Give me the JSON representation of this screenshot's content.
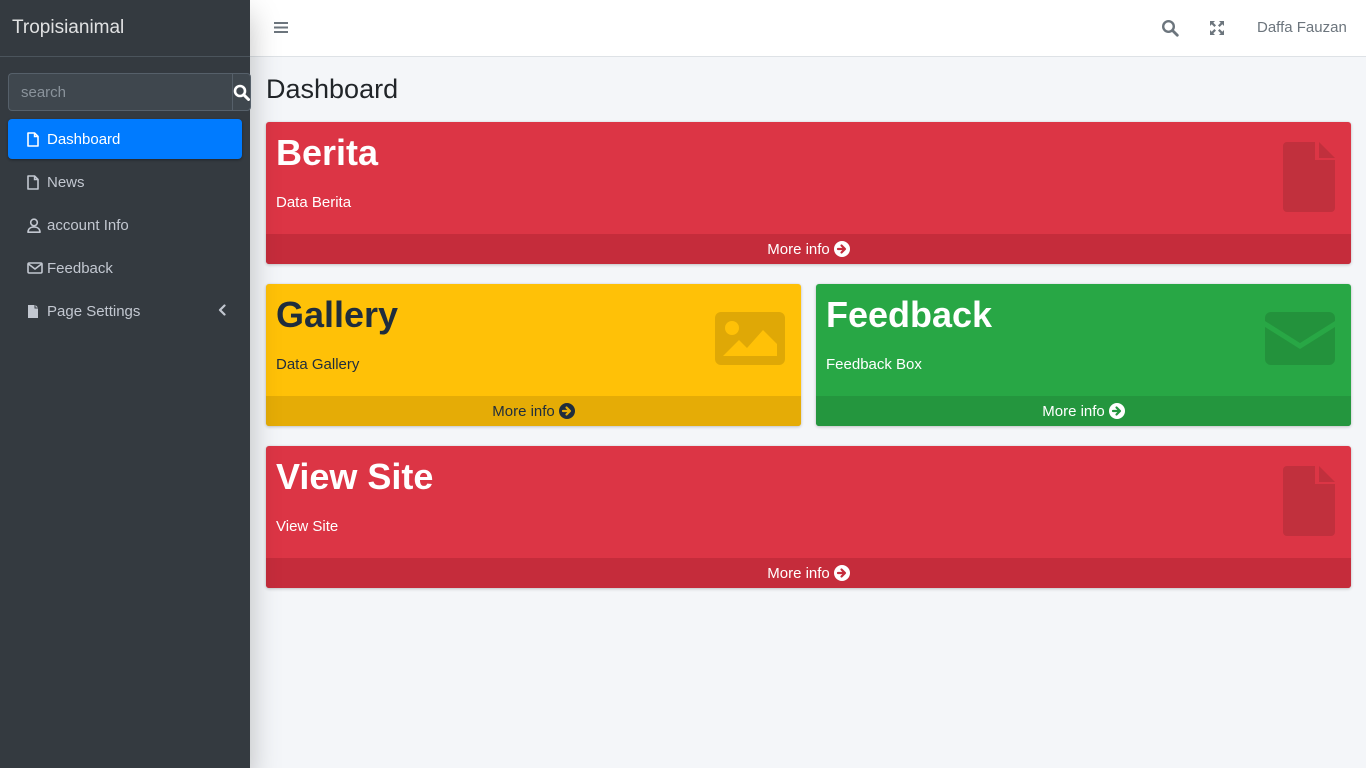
{
  "app": {
    "brand": "Tropisianimal"
  },
  "sidebar": {
    "search": {
      "placeholder": "search",
      "value": ""
    },
    "items": [
      {
        "label": "Dashboard",
        "icon": "file-icon",
        "active": true
      },
      {
        "label": "News",
        "icon": "file-icon"
      },
      {
        "label": "account Info",
        "icon": "user-icon"
      },
      {
        "label": "Feedback",
        "icon": "envelope-icon"
      },
      {
        "label": "Page Settings",
        "icon": "file-filled-icon",
        "has_caret": true
      }
    ]
  },
  "topbar": {
    "user_name": "Daffa Fauzan",
    "icons": [
      "menu-icon",
      "search-icon",
      "expand-icon"
    ]
  },
  "page": {
    "title": "Dashboard"
  },
  "boxes": [
    {
      "title": "Berita",
      "subtitle": "Data Berita",
      "footer": "More info",
      "color": "#dc3545",
      "icon": "file-icon"
    },
    {
      "title": "Gallery",
      "subtitle": "Data Gallery",
      "footer": "More info",
      "color": "#ffc107",
      "icon": "image-icon"
    },
    {
      "title": "Feedback",
      "subtitle": "Feedback Box",
      "footer": "More info",
      "color": "#28a745",
      "icon": "envelope-icon"
    },
    {
      "title": "View Site",
      "subtitle": "View Site",
      "footer": "More info",
      "color": "#dc3545",
      "icon": "file-icon"
    }
  ]
}
